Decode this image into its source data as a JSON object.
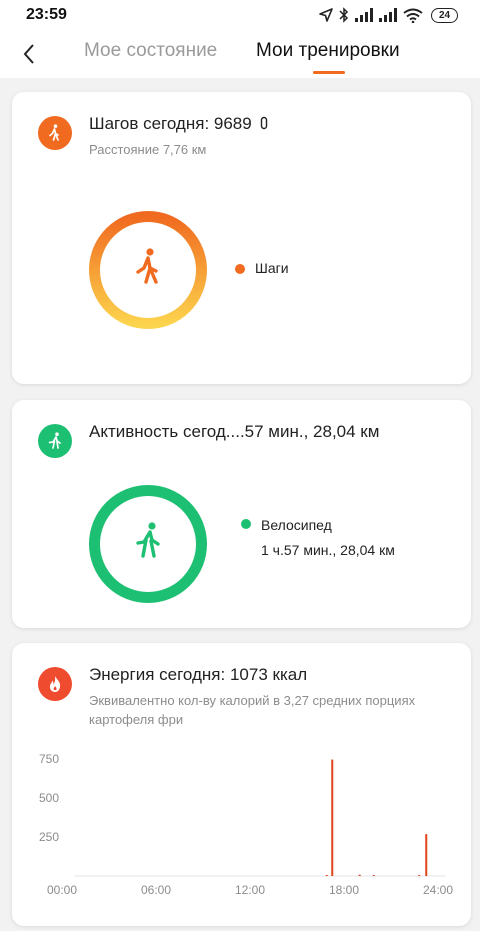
{
  "status_bar": {
    "time": "23:59",
    "battery": "24",
    "icons": [
      "location-icon",
      "bluetooth-icon",
      "signal-icon",
      "signal-icon",
      "wifi-icon",
      "battery-icon"
    ]
  },
  "header": {
    "back_icon": "back-arrow-icon",
    "tabs": [
      {
        "label": "Мое состояние",
        "active": false
      },
      {
        "label": "Мои тренировки",
        "active": true
      }
    ],
    "accent": "#f06a1f"
  },
  "steps_card": {
    "title": "Шагов сегодня: 9689",
    "subtitle": "Расстояние 7,76 км",
    "icon": "walking-icon",
    "icon_color": "#f06a1f",
    "ring_colors": [
      "#f06a1f",
      "#fcd34d"
    ],
    "legend": {
      "label": "Шаги",
      "color": "#f06a1f"
    }
  },
  "activity_card": {
    "title": "Активность сегод....57 мин., 28,04 км",
    "icon": "running-icon",
    "icon_color": "#1dbf73",
    "ring_color": "#1dbf73",
    "legend": {
      "label": "Велосипед",
      "detail": "1 ч.57 мин., 28,04 км",
      "color": "#1dbf73"
    }
  },
  "energy_card": {
    "title": "Энергия сегодня: 1073 ккал",
    "subtitle": "Эквивалентно кол-ву калорий в 3,27 средних порциях картофеля фри",
    "icon": "flame-icon",
    "icon_color": "#ef4b2f"
  },
  "chart_data": {
    "type": "bar",
    "color": "#e0441c",
    "x_ticks": [
      "00:00",
      "06:00",
      "12:00",
      "18:00",
      "24:00"
    ],
    "x_range": [
      0,
      24
    ],
    "y_ticks": [
      "250",
      "500",
      "750"
    ],
    "ylim": [
      0,
      800
    ],
    "grid": false,
    "points": [
      {
        "x": 17.25,
        "y": 745
      },
      {
        "x": 23.25,
        "y": 268
      },
      {
        "x": 16.9,
        "y": 6
      },
      {
        "x": 19.0,
        "y": 8
      },
      {
        "x": 19.9,
        "y": 6
      },
      {
        "x": 22.8,
        "y": 5
      }
    ]
  }
}
